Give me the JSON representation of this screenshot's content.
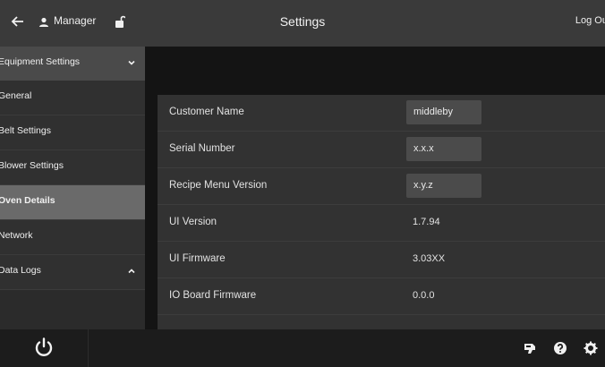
{
  "header": {
    "user_role": "Manager",
    "title": "Settings",
    "logout_label": "Log Out"
  },
  "sidebar": {
    "section_label": "Equipment Settings",
    "items": [
      {
        "label": "General"
      },
      {
        "label": "Belt Settings"
      },
      {
        "label": "Blower Settings"
      },
      {
        "label": "Oven Details"
      },
      {
        "label": "Network"
      }
    ],
    "data_logs_label": "Data Logs",
    "active_item": "Oven Details"
  },
  "details": {
    "rows": [
      {
        "label": "Customer Name",
        "value": "middleby"
      },
      {
        "label": "Serial Number",
        "value": "x.x.x"
      },
      {
        "label": "Recipe Menu Version",
        "value": "x.y.z"
      },
      {
        "label": "UI Version",
        "value": "1.7.94"
      },
      {
        "label": "UI Firmware",
        "value": "3.03XX"
      },
      {
        "label": "IO Board Firmware",
        "value": "0.0.0"
      }
    ]
  },
  "icons": {
    "back": "back-arrow-icon",
    "user": "user-icon",
    "lock": "unlock-icon",
    "power": "power-icon",
    "service": "service-icon",
    "help": "help-icon",
    "settings": "gear-icon"
  },
  "colors": {
    "topbar": "#3a3a3a",
    "sidebar_active": "#6a6a6a",
    "card": "#323232",
    "background": "#141414"
  }
}
